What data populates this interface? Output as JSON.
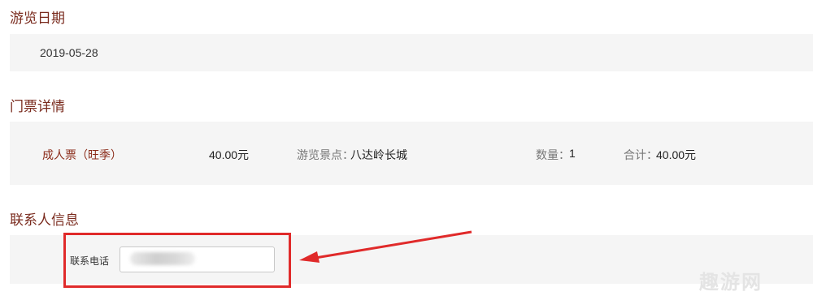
{
  "visit": {
    "title": "游览日期",
    "date": "2019-05-28"
  },
  "tickets": {
    "title": "门票详情",
    "items": [
      {
        "name": "成人票（旺季）",
        "price": "40.00元",
        "spot_label": "游览景点：",
        "spot_value": "八达岭长城",
        "qty_label": "数量：",
        "qty_value": "1",
        "total_label": "合计：",
        "total_value": "40.00元"
      }
    ]
  },
  "contact": {
    "title": "联系人信息",
    "phone_label": "联系电话",
    "phone_value": ""
  },
  "annotation": {
    "highlight_color": "#e02a2a",
    "watermark": "趣游网"
  }
}
